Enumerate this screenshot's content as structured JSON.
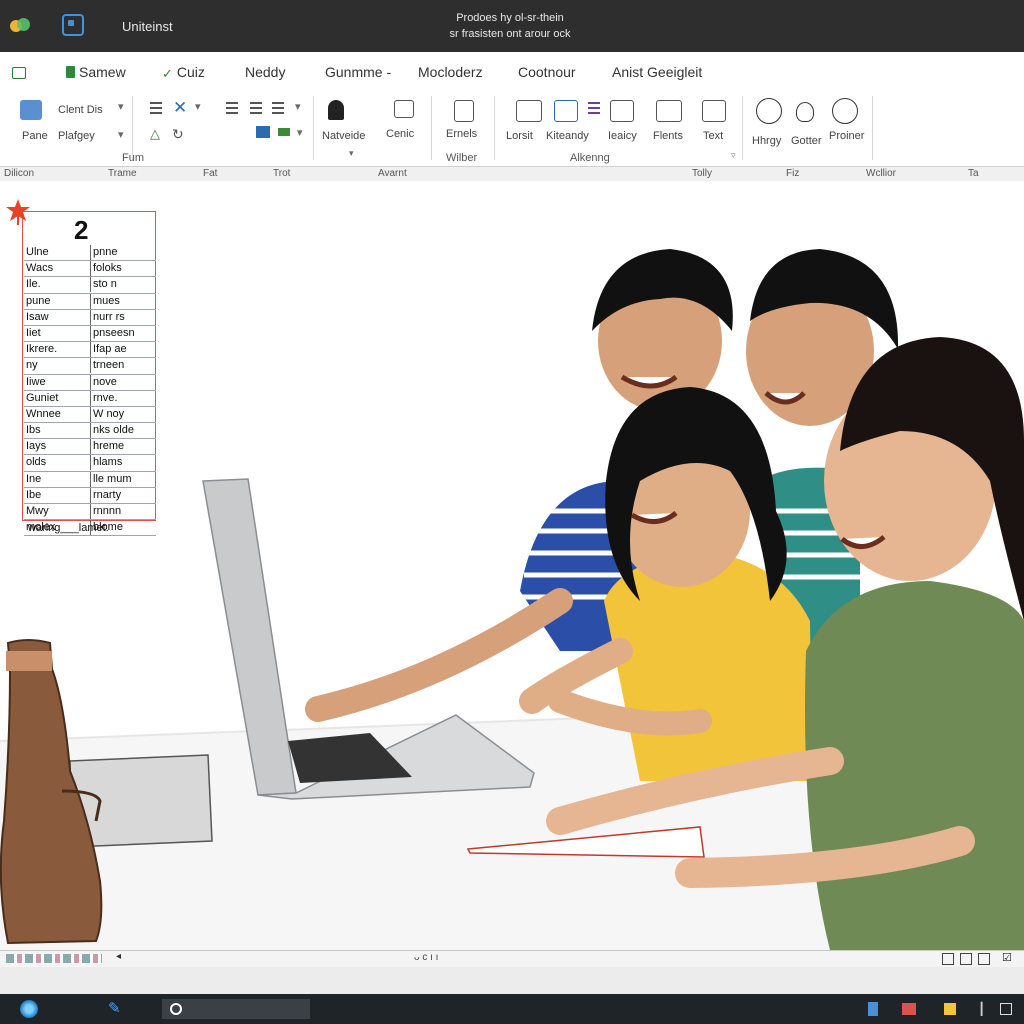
{
  "window": {
    "title": "Uniteinst",
    "doc_title_line1": "Prodoes hy ol-sr-thein",
    "doc_title_line2": "sr frasisten ont arour ock"
  },
  "menu": {
    "tabs": [
      {
        "label": "Samew",
        "icon": "save-icon"
      },
      {
        "label": "Cuiz",
        "icon": "check-icon"
      },
      {
        "label": "Neddy"
      },
      {
        "label": "Gunmme -"
      },
      {
        "label": "Mocloderz"
      },
      {
        "label": "Cootnour"
      },
      {
        "label": "Anist Geeigleit"
      }
    ]
  },
  "ribbon": {
    "clipboard": {
      "item1": "Clent Dis",
      "item2": "Plafgey",
      "item3": "Pane"
    },
    "font_group_caption": "Fum",
    "insert": {
      "item1": "Natveide",
      "item2": "Cenic"
    },
    "embed": {
      "item1": "Ernels",
      "caption": "Wilber"
    },
    "alignment": {
      "items": [
        "Lorsit",
        "Kiteandy",
        "Ieaicy",
        "Flents",
        "Text"
      ],
      "caption": "Alkenng"
    },
    "extras": {
      "items": [
        "Hhrgy",
        "Gotter",
        "Proiner"
      ]
    }
  },
  "column_headers": [
    "Dilicon",
    "Trame",
    "Fat",
    "Trot",
    "Avarnt",
    "Tolly",
    "Fiz",
    "Wcllior",
    "Ta"
  ],
  "sheet": {
    "number": "2",
    "rows": [
      [
        "Ulne",
        "pnne"
      ],
      [
        "Wacs",
        "foloks"
      ],
      [
        "Ile.",
        "sto n"
      ],
      [
        "pune",
        "mues"
      ],
      [
        "Isaw",
        "nurr rs"
      ],
      [
        "Iiet",
        "pnseesn"
      ],
      [
        "Ikrere.",
        "Ifap ae"
      ],
      [
        "ny",
        "trneen"
      ],
      [
        "Iiwe",
        "nove"
      ],
      [
        "Guniet",
        "rnve."
      ],
      [
        "Wnnee",
        "W noy"
      ],
      [
        "Ibs",
        "nks olde"
      ],
      [
        "Iays",
        "hreme"
      ],
      [
        "olds",
        "hlams"
      ],
      [
        "Ine",
        "lle mum"
      ],
      [
        "Ibe",
        "rnarty"
      ],
      [
        "Mwy",
        "rnnnn"
      ],
      [
        "molex",
        "blome"
      ]
    ],
    "footer": "waring___lamet."
  },
  "status": {
    "center_text": "ᴗ ᴄ ı ı"
  },
  "colors": {
    "titlebar": "#2e2e2e",
    "accent_red": "#d9534f",
    "taskbar": "#1f2428"
  }
}
